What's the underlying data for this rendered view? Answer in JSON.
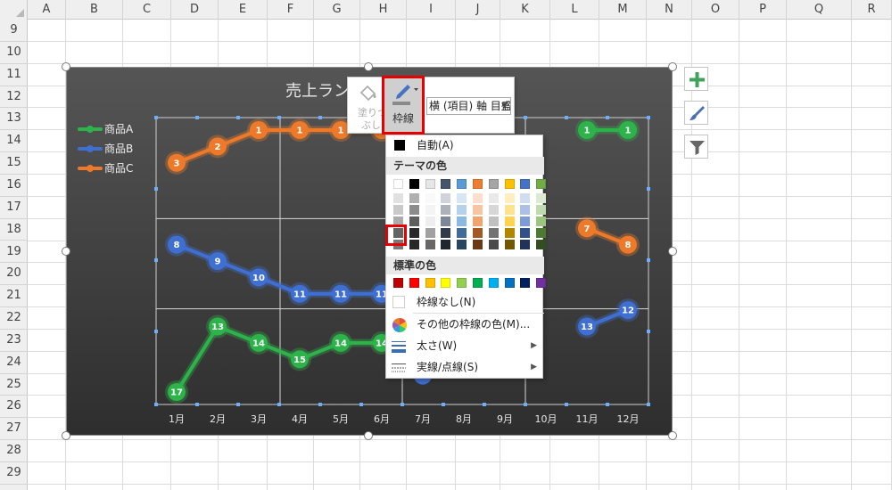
{
  "columns": [
    "A",
    "B",
    "C",
    "D",
    "E",
    "F",
    "G",
    "H",
    "I",
    "J",
    "K",
    "L",
    "M",
    "N",
    "O",
    "P",
    "Q",
    "R"
  ],
  "rows": [
    "9",
    "10",
    "11",
    "12",
    "13",
    "14",
    "15",
    "16",
    "17",
    "18",
    "19",
    "20",
    "21",
    "22",
    "23",
    "24",
    "25",
    "26",
    "27",
    "28",
    "29"
  ],
  "chart": {
    "title": "売上ラン",
    "legend": [
      {
        "name": "商品A",
        "color": "#2db34a"
      },
      {
        "name": "商品B",
        "color": "#3f6fd1"
      },
      {
        "name": "商品C",
        "color": "#ec7a2a"
      }
    ]
  },
  "chart_data": {
    "type": "line",
    "title": "売上ラン",
    "categories": [
      "1月",
      "2月",
      "3月",
      "4月",
      "5月",
      "6月",
      "7月",
      "8月",
      "9月",
      "10月",
      "11月",
      "12月"
    ],
    "y_reversed": true,
    "ylim": [
      1,
      17
    ],
    "series": [
      {
        "name": "商品A",
        "color": "#2db34a",
        "values": [
          17,
          13,
          14,
          15,
          14,
          14,
          null,
          null,
          null,
          null,
          1,
          1
        ]
      },
      {
        "name": "商品B",
        "color": "#3f6fd1",
        "values": [
          8,
          9,
          10,
          11,
          11,
          11,
          null,
          null,
          null,
          null,
          13,
          12
        ]
      },
      {
        "name": "商品C",
        "color": "#ec7a2a",
        "values": [
          3,
          2,
          1,
          1,
          1,
          1,
          null,
          null,
          null,
          null,
          7,
          8
        ]
      }
    ]
  },
  "side_buttons": [
    {
      "name": "chart-elements-button",
      "icon": "plus-icon"
    },
    {
      "name": "chart-styles-button",
      "icon": "brush-icon"
    },
    {
      "name": "chart-filter-button",
      "icon": "filter-icon"
    }
  ],
  "mini_toolbar": {
    "fill_label": "塗りつぶし",
    "fill_line1": "塗りつ",
    "fill_line2": "ぶし",
    "outline_label": "枠線",
    "axis_select": "横 (項目) 軸 目盛"
  },
  "dropdown": {
    "auto": "自動(A)",
    "theme_colors_heading": "テーマの色",
    "theme_colors": [
      "#ffffff",
      "#000000",
      "#e7e6e6",
      "#44546a",
      "#5b9bd5",
      "#ed7d31",
      "#a5a5a5",
      "#ffc000",
      "#4472c4",
      "#70ad47"
    ],
    "standard_colors_heading": "標準の色",
    "standard_colors": [
      "#c00000",
      "#ff0000",
      "#ffc000",
      "#ffff00",
      "#92d050",
      "#00b050",
      "#00b0f0",
      "#0070c0",
      "#002060",
      "#7030a0"
    ],
    "no_outline": "枠線なし(N)",
    "more_colors": "その他の枠線の色(M)...",
    "weight": "太さ(W)",
    "dashes": "実線/点線(S)",
    "accent": "#e60000"
  }
}
